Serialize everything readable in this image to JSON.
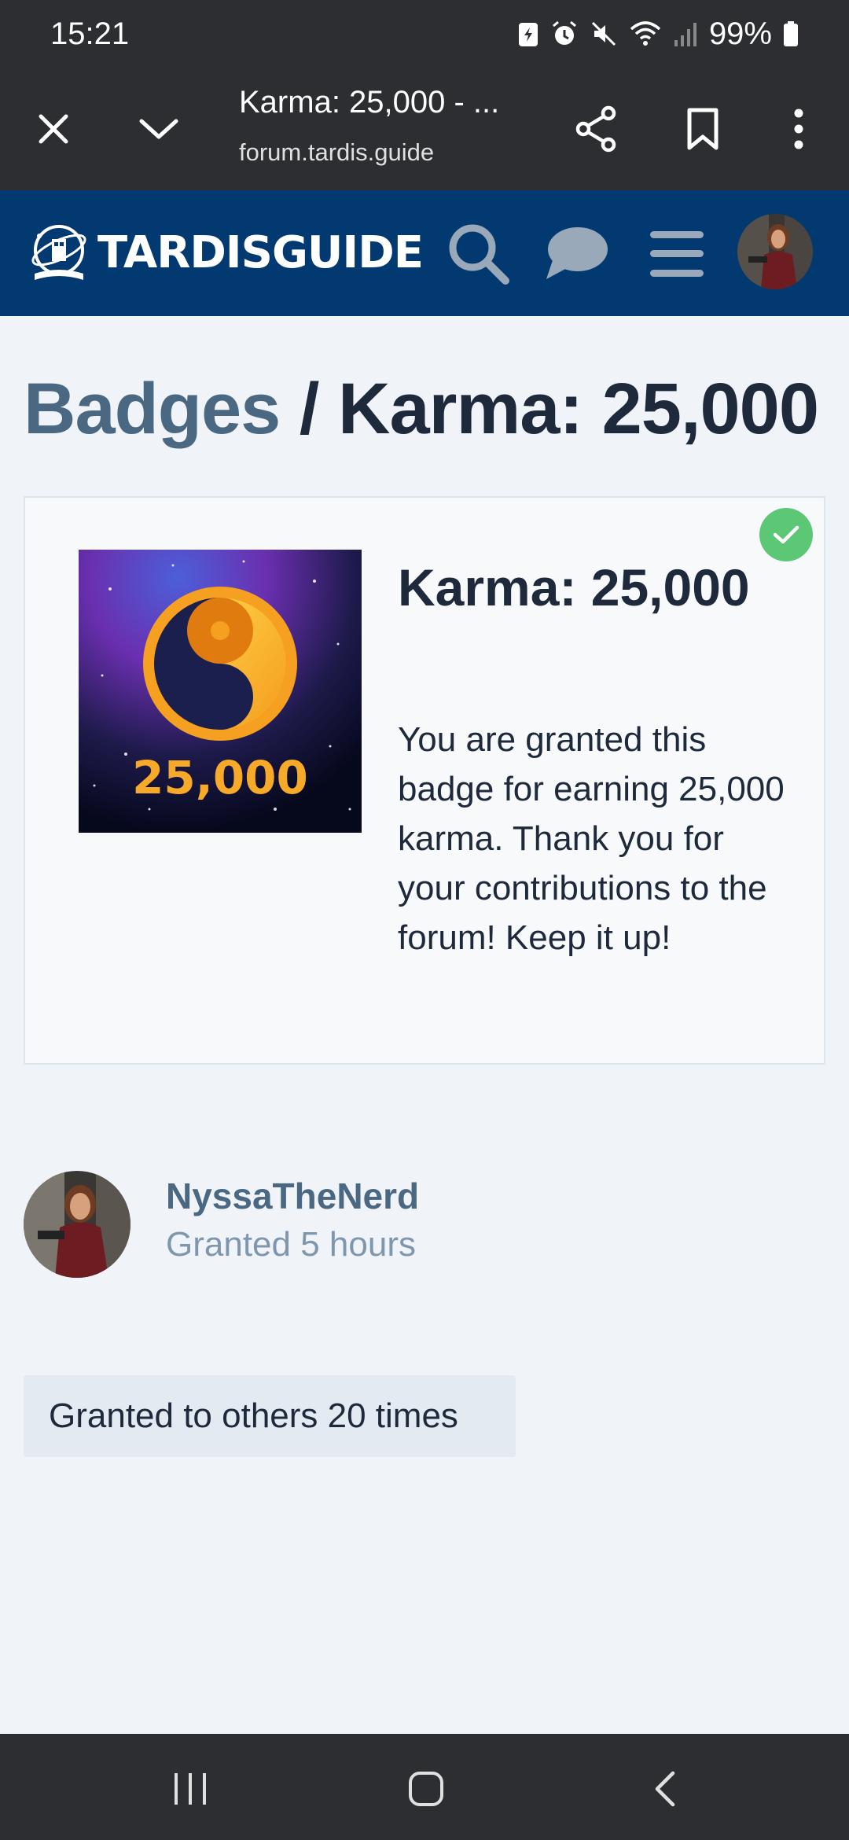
{
  "status_bar": {
    "time": "15:21",
    "battery": "99%"
  },
  "browser": {
    "page_title": "Karma: 25,000 - ...",
    "url": "forum.tardis.guide"
  },
  "site": {
    "logo_text": "TARDISGUIDE",
    "brand_color": "#033971"
  },
  "page": {
    "breadcrumb": "Badges",
    "separator": "/",
    "title": "Karma: 25,000"
  },
  "badge": {
    "name": "Karma: 25,000",
    "image_number": "25,000",
    "description": "You are granted this badge for earning 25,000 karma. Thank you for your contributions to the forum! Keep it up!",
    "owned": true,
    "owned_color": "#5cc775"
  },
  "grantee": {
    "username": "NyssaTheNerd",
    "granted": "Granted 5 hours"
  },
  "others": {
    "label": "Granted to others 20 times"
  },
  "icons": {
    "close": "close-icon",
    "chevron": "chevron-down-icon",
    "share": "share-icon",
    "bookmark": "bookmark-icon",
    "more": "more-vert-icon",
    "search": "search-icon",
    "chat": "chat-icon",
    "menu": "menu-icon"
  }
}
